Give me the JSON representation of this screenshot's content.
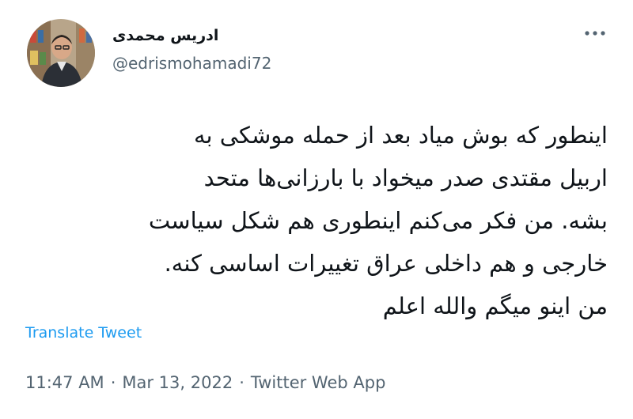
{
  "author": {
    "display_name": "ادریس محمدی",
    "handle": "@edrismohamadi72"
  },
  "icons": {
    "more": "more-dots-icon"
  },
  "tweet": {
    "text": "اینطور که بوش میاد بعد از حمله موشکی به\nاربیل مقتدی صدر میخواد با بارزانی‌ها متحد\nبشه. من فکر می‌کنم اینطوری هم شکل سیاست\nخارجی و هم داخلی عراق تغییرات اساسی کنه.\nمن اینو میگم والله اعلم",
    "translate_label": "Translate Tweet"
  },
  "meta": {
    "time": "11:47 AM",
    "separator_1": "·",
    "date": "Mar 13, 2022",
    "separator_2": "·",
    "source": "Twitter Web App"
  },
  "colors": {
    "link": "#1d9bf0",
    "secondary_text": "#536471",
    "primary_text": "#0f1419"
  }
}
